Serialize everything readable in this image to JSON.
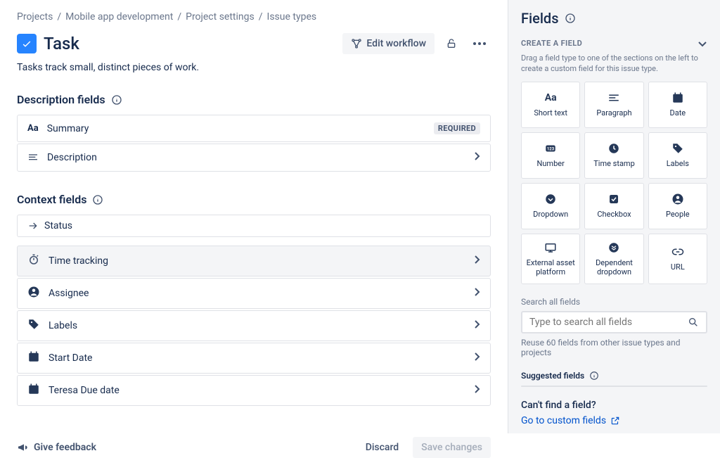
{
  "breadcrumb": [
    "Projects",
    "Mobile app development",
    "Project settings",
    "Issue types"
  ],
  "title": "Task",
  "subtitle": "Tasks track small, distinct pieces of work.",
  "editWorkflow": "Edit workflow",
  "sections": {
    "description": {
      "title": "Description fields",
      "fields": [
        {
          "icon": "Aa",
          "label": "Summary",
          "required": true,
          "requiredBadge": "REQUIRED",
          "chevron": false
        },
        {
          "icon": "desc",
          "label": "Description",
          "required": false,
          "chevron": true
        }
      ]
    },
    "context": {
      "title": "Context fields",
      "statusLabel": "Status",
      "fields": [
        {
          "icon": "stopwatch",
          "label": "Time tracking",
          "highlight": true
        },
        {
          "icon": "person",
          "label": "Assignee",
          "highlight": false
        },
        {
          "icon": "tag",
          "label": "Labels",
          "highlight": false
        },
        {
          "icon": "cal",
          "label": "Start Date",
          "highlight": false
        },
        {
          "icon": "cal",
          "label": "Teresa Due date",
          "highlight": false
        }
      ]
    }
  },
  "footer": {
    "feedback": "Give feedback",
    "discard": "Discard",
    "save": "Save changes"
  },
  "sidebar": {
    "title": "Fields",
    "createLabel": "CREATE A FIELD",
    "createDesc": "Drag a field type to one of the sections on the left to create a custom field for this issue type.",
    "types": [
      {
        "icon": "Aa",
        "label": "Short text"
      },
      {
        "icon": "para",
        "label": "Paragraph"
      },
      {
        "icon": "cal",
        "label": "Date"
      },
      {
        "icon": "num",
        "label": "Number"
      },
      {
        "icon": "clock",
        "label": "Time stamp"
      },
      {
        "icon": "tag",
        "label": "Labels"
      },
      {
        "icon": "drop",
        "label": "Dropdown"
      },
      {
        "icon": "check",
        "label": "Checkbox"
      },
      {
        "icon": "person",
        "label": "People"
      },
      {
        "icon": "ext",
        "label": "External asset platform"
      },
      {
        "icon": "depdrop",
        "label": "Dependent dropdown"
      },
      {
        "icon": "url",
        "label": "URL"
      }
    ],
    "searchLabel": "Search all fields",
    "searchPlaceholder": "Type to search all fields",
    "reuseNote": "Reuse 60 fields from other issue types and projects",
    "suggestedLabel": "Suggested fields",
    "cantFind": "Can't find a field?",
    "goLink": "Go to custom fields"
  }
}
